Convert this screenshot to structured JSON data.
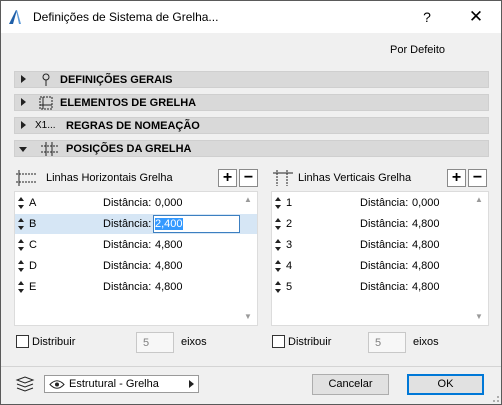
{
  "window": {
    "title": "Definições de Sistema de Grelha...",
    "help": "?",
    "close": "✕"
  },
  "defaults_label": "Por Defeito",
  "sections": {
    "general": "DEFINIÇÕES GERAIS",
    "elements": "ELEMENTOS DE GRELHA",
    "naming": "REGRAS DE NOMEAÇÃO",
    "naming_icon_text": "X1...",
    "positions": "POSIÇÕES DA GRELHA"
  },
  "horizontal": {
    "header": "Linhas Horizontais Grelha",
    "add": "+",
    "remove": "−",
    "rows": [
      {
        "name": "A",
        "label": "Distância:",
        "value": "0,000"
      },
      {
        "name": "B",
        "label": "Distância:",
        "value": "2,400"
      },
      {
        "name": "C",
        "label": "Distância:",
        "value": "4,800"
      },
      {
        "name": "D",
        "label": "Distância:",
        "value": "4,800"
      },
      {
        "name": "E",
        "label": "Distância:",
        "value": "4,800"
      }
    ],
    "distribute_label": "Distribuir",
    "distribute_value": "5",
    "axes_label": "eixos"
  },
  "vertical": {
    "header": "Linhas Verticais Grelha",
    "add": "+",
    "remove": "−",
    "rows": [
      {
        "name": "1",
        "label": "Distância:",
        "value": "0,000"
      },
      {
        "name": "2",
        "label": "Distância:",
        "value": "4,800"
      },
      {
        "name": "3",
        "label": "Distância:",
        "value": "4,800"
      },
      {
        "name": "4",
        "label": "Distância:",
        "value": "4,800"
      },
      {
        "name": "5",
        "label": "Distância:",
        "value": "4,800"
      }
    ],
    "distribute_label": "Distribuir",
    "distribute_value": "5",
    "axes_label": "eixos"
  },
  "footer": {
    "layer_value": "Estrutural - Grelha",
    "cancel": "Cancelar",
    "ok": "OK"
  },
  "icons": [
    "app-icon",
    "pin-icon",
    "grid-elements-icon",
    "naming-icon",
    "grid-positions-icon",
    "horizontal-lines-icon",
    "vertical-lines-icon",
    "updown-arrow-icon",
    "layers-icon",
    "eye-icon",
    "resize-grip-icon"
  ]
}
